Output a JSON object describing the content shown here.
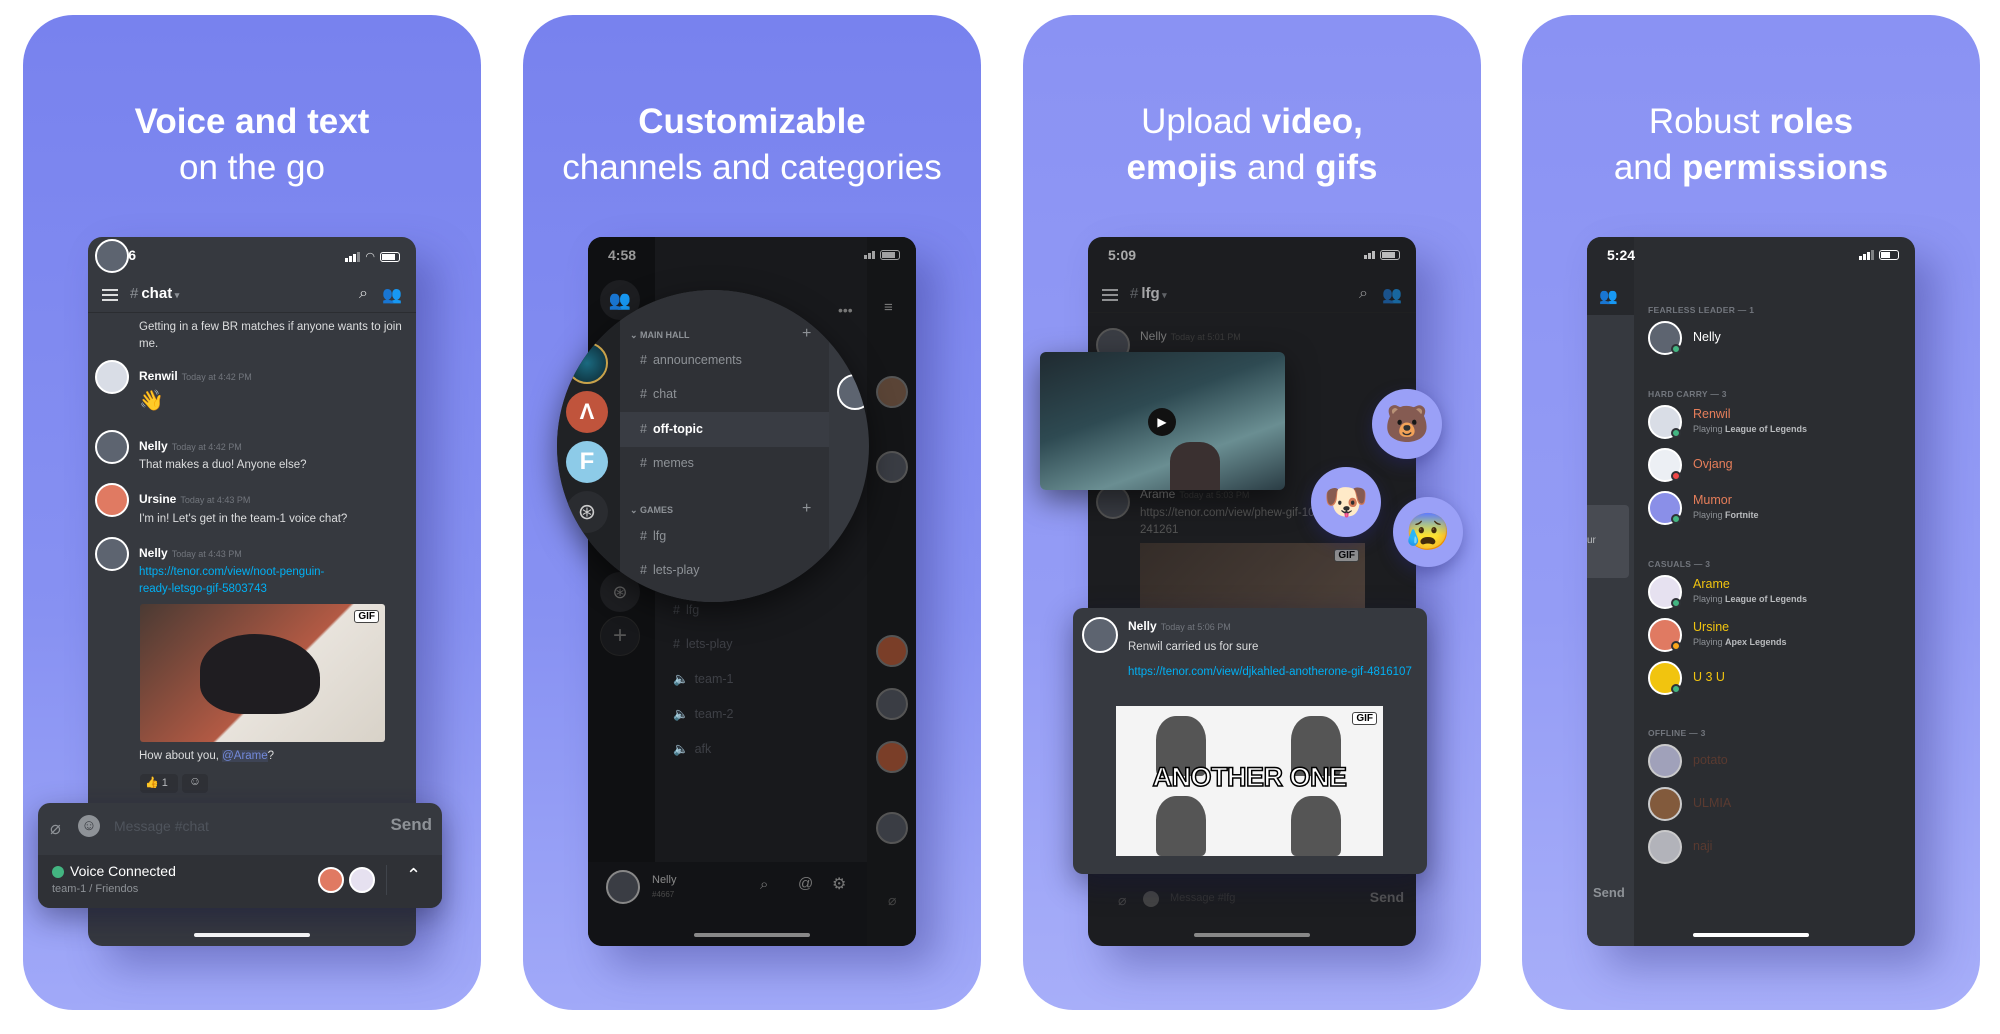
{
  "colors": {
    "accent": "#7289da",
    "link": "#00b0f4",
    "online": "#43b581",
    "dnd": "#f04747",
    "idle": "#faa61a",
    "role_hard_carry": "#e67e5a",
    "role_casuals": "#f1c40f"
  },
  "panels": [
    {
      "title": [
        [
          {
            "text": "Voice and text",
            "bold": true
          }
        ],
        [
          {
            "text": "on the go",
            "bold": false
          }
        ]
      ],
      "phone": {
        "time": "4:46",
        "channel": "chat",
        "messages": [
          {
            "author": "",
            "time": "",
            "text": "Getting in a few BR matches if anyone wants to join me."
          },
          {
            "author": "Renwil",
            "time": "Today at 4:42 PM",
            "text": "👋"
          },
          {
            "author": "Nelly",
            "time": "Today at 4:42 PM",
            "text": "That makes a duo! Anyone else?"
          },
          {
            "author": "Ursine",
            "time": "Today at 4:43 PM",
            "text": "I'm in! Let's get in the team-1 voice chat?"
          },
          {
            "author": "Nelly",
            "time": "Today at 4:43 PM",
            "link": "https://tenor.com/view/noot-penguin-ready-letsgo-gif-5803743",
            "gif_badge": "GIF",
            "text_before": "How about you, ",
            "mention": "@Arame",
            "text_after": "?"
          }
        ],
        "reaction": {
          "emoji": "👍",
          "count": "1"
        },
        "input_placeholder": "Message #chat",
        "send": "Send",
        "voice": {
          "status": "Voice Connected",
          "location": "team-1 / Friendos"
        }
      }
    },
    {
      "title": [
        [
          {
            "text": "Customizable",
            "bold": true
          }
        ],
        [
          {
            "text": "channels and categories",
            "bold": false
          }
        ]
      ],
      "phone": {
        "time": "4:58",
        "categories": [
          {
            "name": "MAIN HALL",
            "channels": [
              "announcements",
              "chat",
              "off-topic",
              "memes"
            ]
          },
          {
            "name": "GAMES",
            "channels": [
              "lfg",
              "lets-play"
            ]
          }
        ],
        "selected_channel": "off-topic",
        "dim_channels": [
          {
            "name": "lfg",
            "type": "text"
          },
          {
            "name": "lets-play",
            "type": "text"
          },
          {
            "name": "team-1",
            "type": "voice"
          },
          {
            "name": "team-2",
            "type": "voice"
          },
          {
            "name": "afk",
            "type": "voice"
          }
        ],
        "user": {
          "name": "Nelly",
          "tag": "#4667"
        }
      }
    },
    {
      "title": [
        [
          {
            "text": "Upload ",
            "bold": false
          },
          {
            "text": "video,",
            "bold": true
          }
        ],
        [
          {
            "text": "emojis",
            "bold": true
          },
          {
            "text": " and ",
            "bold": false
          },
          {
            "text": "gifs",
            "bold": true
          }
        ]
      ],
      "phone": {
        "time": "5:09",
        "channel": "lfg",
        "bg_messages": [
          {
            "author": "Nelly",
            "time": "Today at 5:01 PM"
          },
          {
            "author": "Arame",
            "time": "Today at 5:03 PM",
            "link": "https://tenor.com/view/phew-gif-10241261"
          }
        ],
        "gif_badge": "GIF",
        "card": {
          "author": "Nelly",
          "time": "Today at 5:06 PM",
          "text": "Renwil carried us for sure",
          "link": "https://tenor.com/view/djkahled-anotherone-gif-4816107",
          "gif_text": "ANOTHER ONE",
          "gif_badge": "GIF"
        },
        "input_placeholder": "Message #lfg",
        "send": "Send"
      }
    },
    {
      "title": [
        [
          {
            "text": "Robust ",
            "bold": false
          },
          {
            "text": "roles",
            "bold": true
          }
        ],
        [
          {
            "text": "and ",
            "bold": false
          },
          {
            "text": "permissions",
            "bold": true
          }
        ]
      ],
      "phone": {
        "time": "5:24",
        "side_text": "ur",
        "send": "Send",
        "sections": [
          {
            "label": "FEARLESS LEADER — 1",
            "members": [
              {
                "name": "Nelly",
                "status": "online",
                "color": "#ffffff"
              }
            ]
          },
          {
            "label": "HARD CARRY — 3",
            "members": [
              {
                "name": "Renwil",
                "activity": "League of Legends",
                "status": "online",
                "color": "#e67e5a"
              },
              {
                "name": "Ovjang",
                "status": "dnd",
                "color": "#e67e5a"
              },
              {
                "name": "Mumor",
                "activity": "Fortnite",
                "status": "online",
                "color": "#e67e5a"
              }
            ]
          },
          {
            "label": "CASUALS — 3",
            "members": [
              {
                "name": "Arame",
                "activity": "League of Legends",
                "status": "online",
                "color": "#f1c40f"
              },
              {
                "name": "Ursine",
                "activity": "Apex Legends",
                "status": "idle",
                "color": "#f1c40f"
              },
              {
                "name": "U 3 U",
                "status": "online",
                "color": "#f1c40f"
              }
            ]
          },
          {
            "label": "OFFLINE — 3",
            "members": [
              {
                "name": "potato",
                "color": "#5a3a30"
              },
              {
                "name": "ULMIA",
                "color": "#5a3a30"
              },
              {
                "name": "naji",
                "color": "#5a3a30"
              }
            ]
          }
        ],
        "playing_label": "Playing "
      }
    }
  ]
}
